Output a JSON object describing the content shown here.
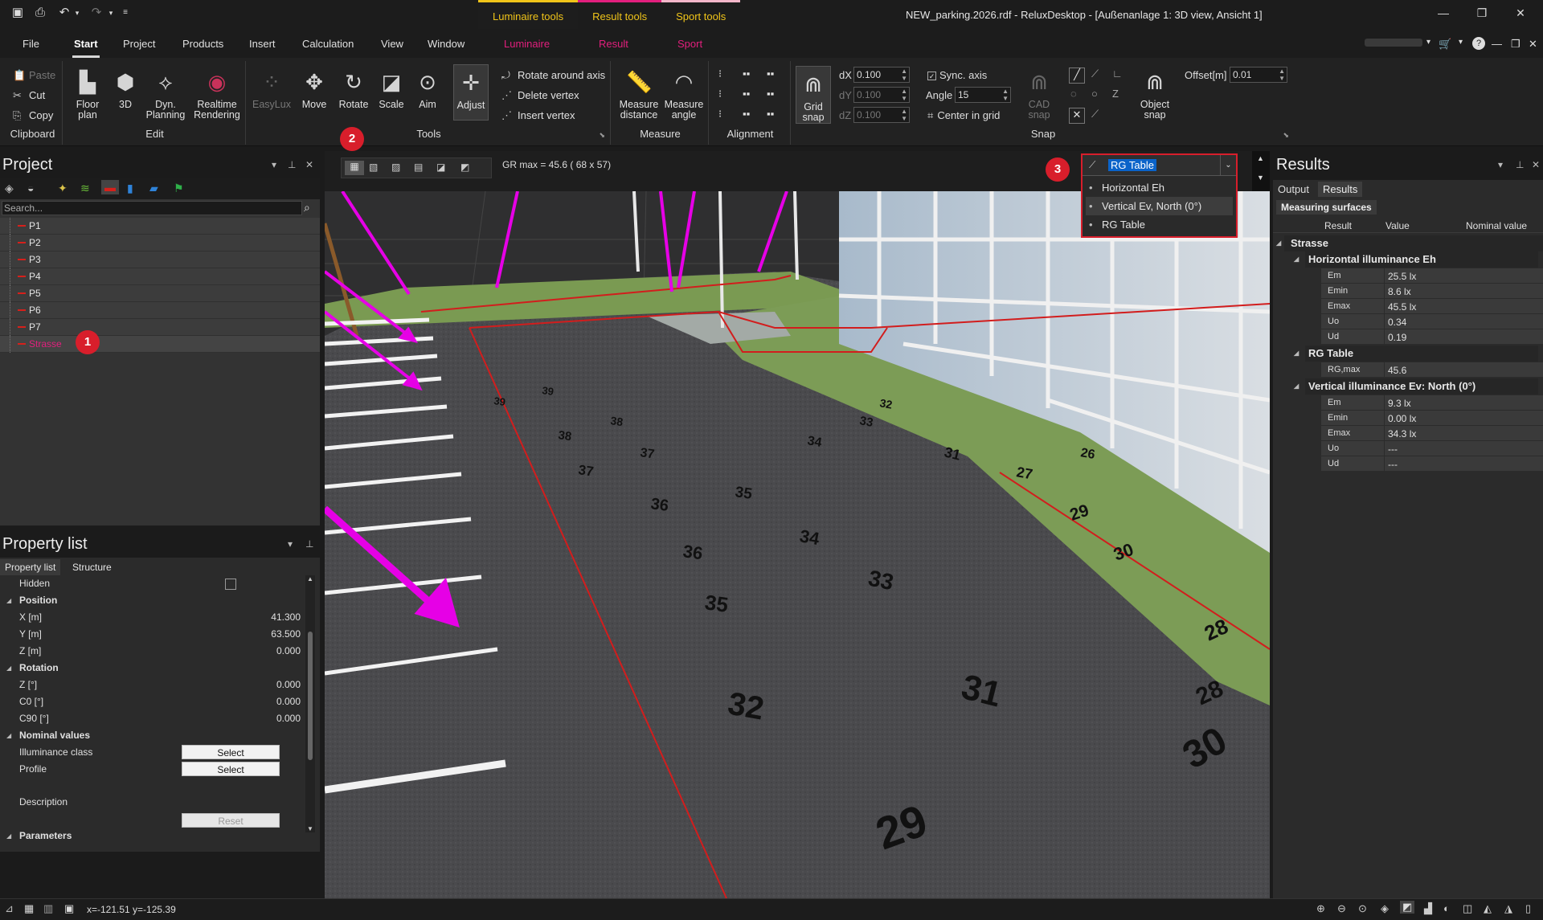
{
  "titlebar": {
    "context_tabs": [
      {
        "label": "Luminaire tools",
        "color": "#f0c419"
      },
      {
        "label": "Result tools",
        "color": "#f0c419"
      },
      {
        "label": "Sport tools",
        "color": "#f0c419"
      }
    ],
    "window_title": "NEW_parking.2026.rdf - ReluxDesktop - [Außenanlage 1: 3D view, Ansicht 1]"
  },
  "menu": {
    "items": [
      "File",
      "Start",
      "Project",
      "Products",
      "Insert",
      "Calculation",
      "View",
      "Window"
    ],
    "context_items": [
      "Luminaire",
      "Result",
      "Sport"
    ],
    "active": "Start"
  },
  "ribbon": {
    "clipboard": {
      "paste": "Paste",
      "cut": "Cut",
      "copy": "Copy",
      "label": "Clipboard"
    },
    "edit": {
      "floor_plan": "Floor plan",
      "threed": "3D",
      "dyn_planning": "Dyn. Planning",
      "realtime": "Realtime Rendering",
      "label": "Edit"
    },
    "tools": {
      "easylux": "EasyLux",
      "move": "Move",
      "rotate": "Rotate",
      "scale": "Scale",
      "aim": "Aim",
      "adjust": "Adjust",
      "rotate_axis": "Rotate around axis",
      "delete_vertex": "Delete vertex",
      "insert_vertex": "Insert vertex",
      "label": "Tools"
    },
    "measure": {
      "distance": "Measure distance",
      "angle": "Measure angle",
      "label": "Measure"
    },
    "alignment": {
      "label": "Alignment"
    },
    "snap": {
      "grid_snap": "Grid snap",
      "dx_label": "dX",
      "dx": "0.100",
      "dy_label": "dY",
      "dy": "0.100",
      "dz_label": "dZ",
      "dz": "0.100",
      "sync_axis": "Sync. axis",
      "angle_label": "Angle",
      "angle": "15",
      "center_grid": "Center in grid",
      "cad_snap": "CAD snap",
      "object_snap": "Object snap",
      "offset_label": "Offset[m]",
      "offset": "0.01",
      "label": "Snap"
    }
  },
  "project": {
    "title": "Project",
    "search_placeholder": "Search...",
    "items": [
      "P1",
      "P2",
      "P3",
      "P4",
      "P5",
      "P6",
      "P7",
      "Strasse"
    ]
  },
  "properties": {
    "title": "Property list",
    "tabs": [
      "Property list",
      "Structure"
    ],
    "hidden": "Hidden",
    "position": "Position",
    "x_label": "X [m]",
    "x": "41.300",
    "y_label": "Y [m]",
    "y": "63.500",
    "z_label": "Z [m]",
    "z": "0.000",
    "rotation": "Rotation",
    "rz_label": "Z [°]",
    "rz": "0.000",
    "c0_label": "C0 [°]",
    "c0": "0.000",
    "c90_label": "C90 [°]",
    "c90": "0.000",
    "nominal": "Nominal values",
    "illum_class": "Illuminance class",
    "profile": "Profile",
    "select": "Select",
    "description": "Description",
    "reset": "Reset",
    "parameters": "Parameters"
  },
  "viewport": {
    "gr_label": "GR max = 45.6 ( 68 x 57)",
    "numbers": [
      "39",
      "39",
      "38",
      "38",
      "37",
      "37",
      "36",
      "36",
      "35",
      "35",
      "34",
      "34",
      "33",
      "33",
      "32",
      "32",
      "31",
      "31",
      "30",
      "30",
      "29",
      "29",
      "28",
      "28",
      "27",
      "26"
    ]
  },
  "dropdown": {
    "selected": "RG Table",
    "options": [
      "Horizontal Eh",
      "Vertical Ev, North (0°)",
      "RG Table"
    ]
  },
  "results": {
    "title": "Results",
    "tabs": [
      "Output",
      "Results"
    ],
    "subtab": "Measuring surfaces",
    "columns": [
      "Result",
      "Value",
      "Nominal value"
    ],
    "surface": "Strasse",
    "groups": [
      {
        "name": "Horizontal illuminance Eh",
        "rows": [
          {
            "k": "Em",
            "v": "25.5 lx"
          },
          {
            "k": "Emin",
            "v": "8.6 lx"
          },
          {
            "k": "Emax",
            "v": "45.5 lx"
          },
          {
            "k": "Uo",
            "v": "0.34"
          },
          {
            "k": "Ud",
            "v": "0.19"
          }
        ]
      },
      {
        "name": "RG Table",
        "rows": [
          {
            "k": "RG,max",
            "v": "45.6"
          }
        ]
      },
      {
        "name": "Vertical illuminance Ev: North (0°)",
        "rows": [
          {
            "k": "Em",
            "v": "9.3 lx"
          },
          {
            "k": "Emin",
            "v": "0.00 lx"
          },
          {
            "k": "Emax",
            "v": "34.3 lx"
          },
          {
            "k": "Uo",
            "v": "---"
          },
          {
            "k": "Ud",
            "v": "---"
          }
        ]
      }
    ]
  },
  "status": {
    "coords": "x=-121.51 y=-125.39"
  },
  "badges": [
    "1",
    "2",
    "3"
  ],
  "colors": {
    "accent": "#d81e2b",
    "context": "#e21f7d",
    "highlight": "#0a63c9"
  }
}
